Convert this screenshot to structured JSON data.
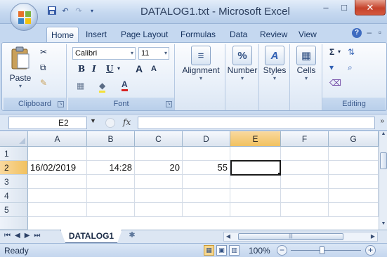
{
  "window": {
    "title": "DATALOG1.txt - Microsoft Excel",
    "minimize_glyph": "–",
    "maximize_glyph": "□",
    "close_glyph": "✕"
  },
  "quick_access": {
    "save_icon": "save-icon",
    "undo_icon": "undo-icon",
    "redo_icon": "redo-icon"
  },
  "ribbon_tabs": [
    "Home",
    "Insert",
    "Page Layout",
    "Formulas",
    "Data",
    "Review",
    "View"
  ],
  "ribbon": {
    "clipboard": {
      "label": "Clipboard",
      "paste": "Paste"
    },
    "font": {
      "label": "Font",
      "font_name": "Calibri",
      "font_size": "11",
      "bold": "B",
      "italic": "I",
      "underline": "U",
      "grow": "A",
      "shrink": "A"
    },
    "alignment": {
      "label": "Alignment"
    },
    "number": {
      "label": "Number",
      "glyph": "%"
    },
    "styles": {
      "label": "Styles"
    },
    "cells": {
      "label": "Cells"
    },
    "editing": {
      "label": "Editing",
      "sum_glyph": "Σ"
    }
  },
  "formula_bar": {
    "name_box": "E2",
    "fx_label": "fx",
    "formula": ""
  },
  "sheet": {
    "columns": [
      "A",
      "B",
      "C",
      "D",
      "E",
      "F",
      "G"
    ],
    "selected_column": "E",
    "selected_row": "2",
    "rows": [
      {
        "num": "1",
        "cells": [
          "",
          "",
          "",
          "",
          "",
          "",
          ""
        ]
      },
      {
        "num": "2",
        "cells": [
          "16/02/2019",
          "14:28",
          "20",
          "55",
          "",
          "",
          ""
        ]
      },
      {
        "num": "3",
        "cells": [
          "",
          "",
          "",
          "",
          "",
          "",
          ""
        ]
      },
      {
        "num": "4",
        "cells": [
          "",
          "",
          "",
          "",
          "",
          "",
          ""
        ]
      },
      {
        "num": "5",
        "cells": [
          "",
          "",
          "",
          "",
          "",
          "",
          ""
        ]
      }
    ]
  },
  "sheet_tabs": {
    "active": "DATALOG1"
  },
  "status_bar": {
    "mode": "Ready",
    "zoom": "100%"
  },
  "colors": {
    "accent": "#c5d8f0",
    "selected_header": "#f1c15f",
    "close_button": "#c5422b"
  }
}
